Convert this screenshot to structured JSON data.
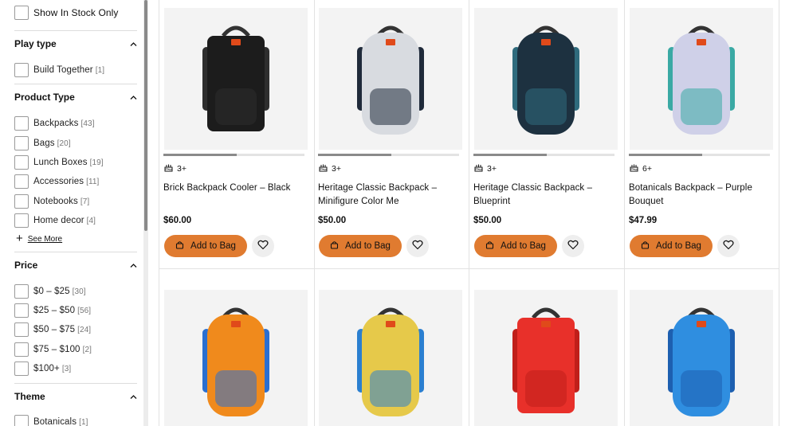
{
  "filters": {
    "in_stock_label": "Show In Stock Only",
    "sections": [
      {
        "title": "Play type",
        "options": [
          {
            "label": "Build Together",
            "count": "[1]"
          }
        ]
      },
      {
        "title": "Product Type",
        "options": [
          {
            "label": "Backpacks",
            "count": "[43]"
          },
          {
            "label": "Bags",
            "count": "[20]"
          },
          {
            "label": "Lunch Boxes",
            "count": "[19]"
          },
          {
            "label": "Accessories",
            "count": "[11]"
          },
          {
            "label": "Notebooks",
            "count": "[7]"
          },
          {
            "label": "Home decor",
            "count": "[4]"
          }
        ],
        "see_more": "See More"
      },
      {
        "title": "Price",
        "options": [
          {
            "label": "$0 – $25",
            "count": "[30]"
          },
          {
            "label": "$25 – $50",
            "count": "[56]"
          },
          {
            "label": "$50 – $75",
            "count": "[24]"
          },
          {
            "label": "$75 – $100",
            "count": "[2]"
          },
          {
            "label": "$100+",
            "count": "[3]"
          }
        ]
      },
      {
        "title": "Theme",
        "options": [
          {
            "label": "Botanicals",
            "count": "[1]"
          }
        ]
      }
    ]
  },
  "add_to_bag_label": "Add to Bag",
  "products": [
    {
      "name": "Brick Backpack Cooler – Black",
      "age": "3+",
      "price": "$60.00",
      "image_progress": 0.52,
      "color": "#1c1c1c",
      "accent": "#2e2e2e"
    },
    {
      "name": "Heritage Classic Backpack – Minifigure Color Me",
      "age": "3+",
      "price": "$50.00",
      "image_progress": 0.52,
      "color": "#d8dbe0",
      "accent": "#1f2a3a"
    },
    {
      "name": "Heritage Classic Backpack – Blueprint",
      "age": "3+",
      "price": "$50.00",
      "image_progress": 0.52,
      "color": "#1d3140",
      "accent": "#2f6b7d"
    },
    {
      "name": "Botanicals Backpack – Purple Bouquet",
      "age": "6+",
      "price": "$47.99",
      "image_progress": 0.52,
      "color": "#cfd0e8",
      "accent": "#3aa9a4"
    },
    {
      "name": "",
      "color": "#f08a1c",
      "accent": "#2a6fd1"
    },
    {
      "name": "",
      "color": "#e6c94a",
      "accent": "#2b7fd0"
    },
    {
      "name": "",
      "color": "#e8302a",
      "accent": "#c01f1a"
    },
    {
      "name": "",
      "color": "#2f8ee0",
      "accent": "#1d5fb0"
    }
  ]
}
